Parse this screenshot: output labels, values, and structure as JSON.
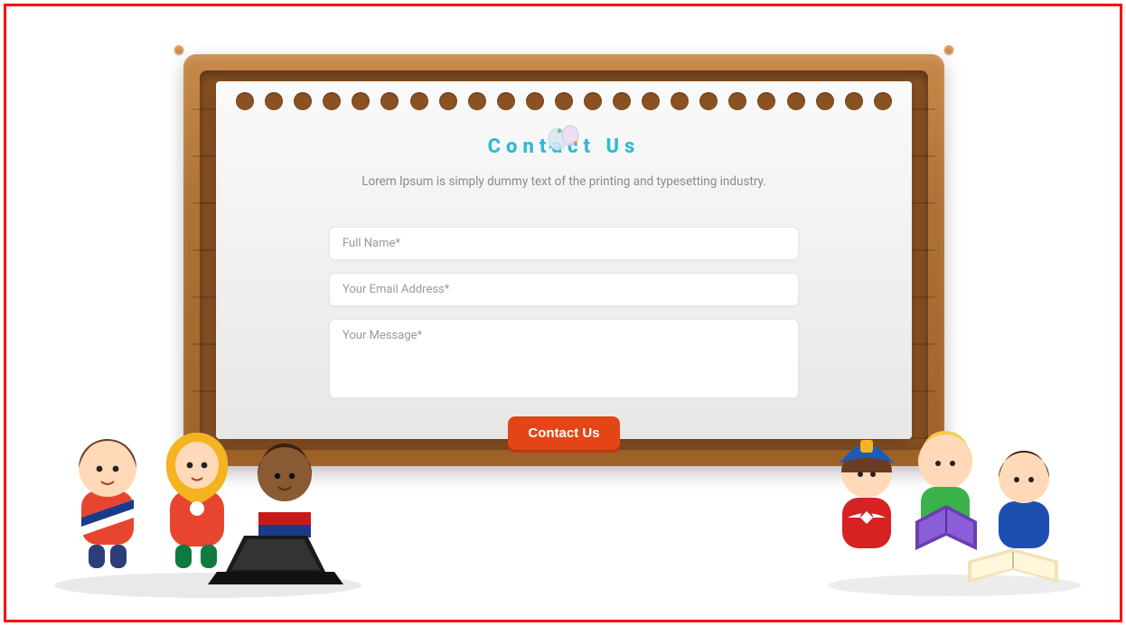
{
  "heading": "Contact Us",
  "subtitle": "Lorem Ipsum is simply dummy text of the printing and typesetting industry.",
  "form": {
    "name_placeholder": "Full Name*",
    "email_placeholder": "Your Email Address*",
    "message_placeholder": "Your Message*",
    "submit_label": "Contact Us"
  },
  "colors": {
    "accent_teal": "#2cbad6",
    "button": "#e34517",
    "frame": "#b07336"
  }
}
